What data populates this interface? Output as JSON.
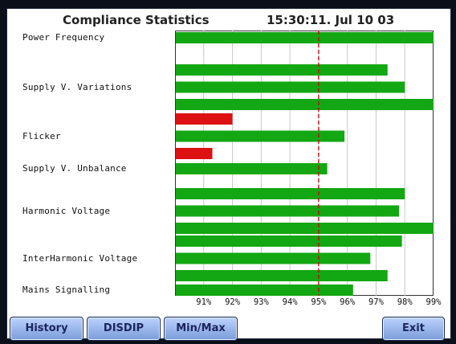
{
  "header": {
    "title": "Compliance Statistics",
    "datetime": "15:30:11. Jul 10 03"
  },
  "chart_data": {
    "type": "bar",
    "orientation": "horizontal",
    "title": "Compliance Statistics",
    "xlim": [
      90,
      99
    ],
    "x_ticks": [
      "91%",
      "92%",
      "93%",
      "94%",
      "95%",
      "96%",
      "97%",
      "98%",
      "99%"
    ],
    "threshold": 95,
    "threshold_color": "#cc0000",
    "grid": true,
    "groups": [
      {
        "label": "Power Frequency",
        "bars": [
          {
            "value": 99.0,
            "color": "#13a713"
          }
        ]
      },
      {
        "label": "Supply V. Variations",
        "bars": [
          {
            "value": 97.4,
            "color": "#13a713"
          },
          {
            "value": 98.0,
            "color": "#13a713"
          },
          {
            "value": 99.0,
            "color": "#13a713"
          }
        ]
      },
      {
        "label": "Flicker",
        "bars": [
          {
            "value": 92.0,
            "color": "#dd1111"
          },
          {
            "value": 95.9,
            "color": "#13a713"
          },
          {
            "value": 91.3,
            "color": "#dd1111"
          }
        ]
      },
      {
        "label": "Supply V. Unbalance",
        "bars": [
          {
            "value": 95.3,
            "color": "#13a713"
          }
        ]
      },
      {
        "label": "Harmonic Voltage",
        "bars": [
          {
            "value": 98.0,
            "color": "#13a713"
          },
          {
            "value": 97.8,
            "color": "#13a713"
          },
          {
            "value": 99.0,
            "color": "#13a713"
          }
        ]
      },
      {
        "label": "InterHarmonic Voltage",
        "bars": [
          {
            "value": 97.9,
            "color": "#13a713"
          },
          {
            "value": 96.8,
            "color": "#13a713"
          },
          {
            "value": 97.4,
            "color": "#13a713"
          }
        ]
      },
      {
        "label": "Mains Signalling",
        "bars": [
          {
            "value": 96.2,
            "color": "#13a713"
          }
        ]
      }
    ]
  },
  "buttons": {
    "history": "History",
    "disdip": "DISDIP",
    "minmax": "Min/Max",
    "exit": "Exit"
  },
  "colors": {
    "bar_green": "#13a713",
    "bar_red": "#dd1111",
    "button_bg": "#9cb8ee",
    "button_text": "#1c2560"
  }
}
